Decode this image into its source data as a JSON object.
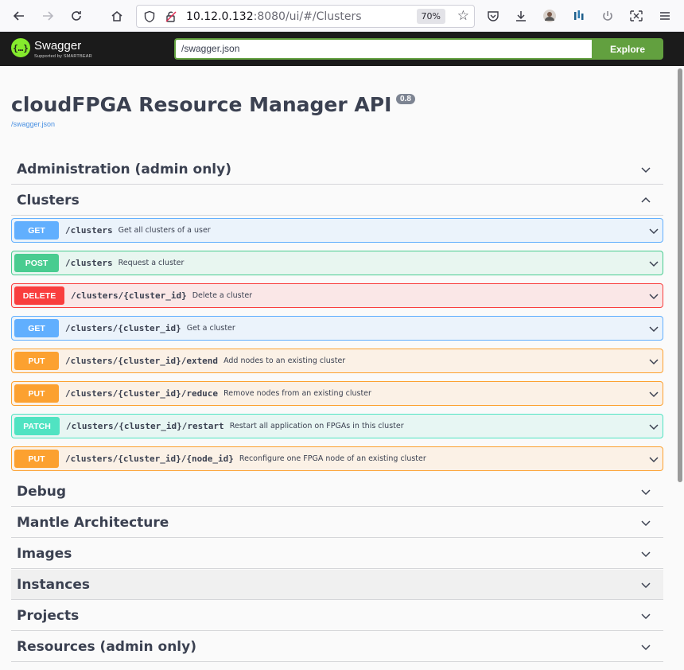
{
  "browser": {
    "url_host": "10.12.0.132",
    "url_rest": ":8080/ui/#/Clusters",
    "zoom": "70%"
  },
  "swagger": {
    "brand": "Swagger",
    "brand_sub": "Supported by SMARTBEAR",
    "spec_input": "/swagger.json",
    "explore_label": "Explore"
  },
  "info": {
    "title": "cloudFPGA Resource Manager API",
    "version": "0.8",
    "spec_link": "/swagger.json"
  },
  "tags": {
    "admin": "Administration (admin only)",
    "clusters": "Clusters",
    "debug": "Debug",
    "mantle": "Mantle Architecture",
    "images": "Images",
    "instances": "Instances",
    "projects": "Projects",
    "resources": "Resources (admin only)"
  },
  "operations": [
    {
      "method": "GET",
      "path": "/clusters",
      "summary": "Get all clusters of a user"
    },
    {
      "method": "POST",
      "path": "/clusters",
      "summary": "Request a cluster"
    },
    {
      "method": "DELETE",
      "path": "/clusters/{cluster_id}",
      "summary": "Delete a cluster"
    },
    {
      "method": "GET",
      "path": "/clusters/{cluster_id}",
      "summary": "Get a cluster"
    },
    {
      "method": "PUT",
      "path": "/clusters/{cluster_id}/extend",
      "summary": "Add nodes to an existing cluster"
    },
    {
      "method": "PUT",
      "path": "/clusters/{cluster_id}/reduce",
      "summary": "Remove nodes from an existing cluster"
    },
    {
      "method": "PATCH",
      "path": "/clusters/{cluster_id}/restart",
      "summary": "Restart all application on FPGAs in this cluster"
    },
    {
      "method": "PUT",
      "path": "/clusters/{cluster_id}/{node_id}",
      "summary": "Reconfigure one FPGA node of an existing cluster"
    }
  ],
  "colors": {
    "get": "#61affe",
    "post": "#49cc90",
    "delete": "#f93e3e",
    "put": "#fca130",
    "patch": "#50e3c2",
    "swagger_green": "#85ea2d",
    "explore_green": "#62a03f"
  }
}
